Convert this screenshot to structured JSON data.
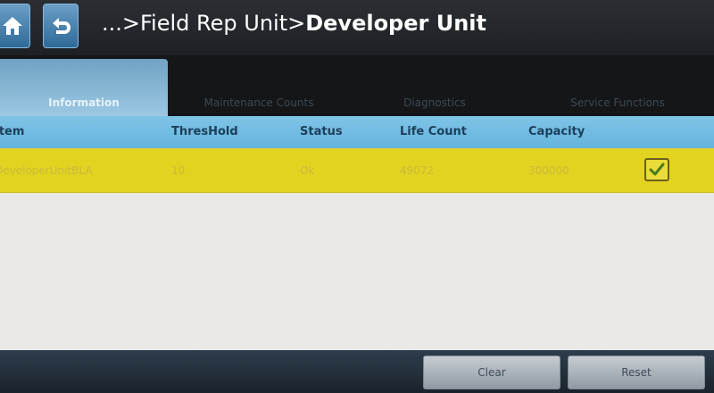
{
  "header": {
    "breadcrumb_prefix": "...>Field Rep Unit>",
    "breadcrumb_current": "Developer Unit"
  },
  "tabs": [
    {
      "label": "Information",
      "active": true
    },
    {
      "label": "Maintenance Counts",
      "active": false
    },
    {
      "label": "Diagnostics",
      "active": false
    },
    {
      "label": "Service Functions",
      "active": false
    }
  ],
  "table": {
    "columns": [
      "Item",
      "ThresHold",
      "Status",
      "Life Count",
      "Capacity"
    ],
    "rows": [
      {
        "item": "DeveloperUnitBLA",
        "threshold": "10",
        "status": "Ok",
        "life_count": "49072",
        "capacity": "300000",
        "checked": true
      }
    ]
  },
  "footer": {
    "clear_label": "Clear",
    "reset_label": "Reset"
  },
  "colors": {
    "accent": "#64b4de",
    "row_highlight": "#e3d321"
  }
}
